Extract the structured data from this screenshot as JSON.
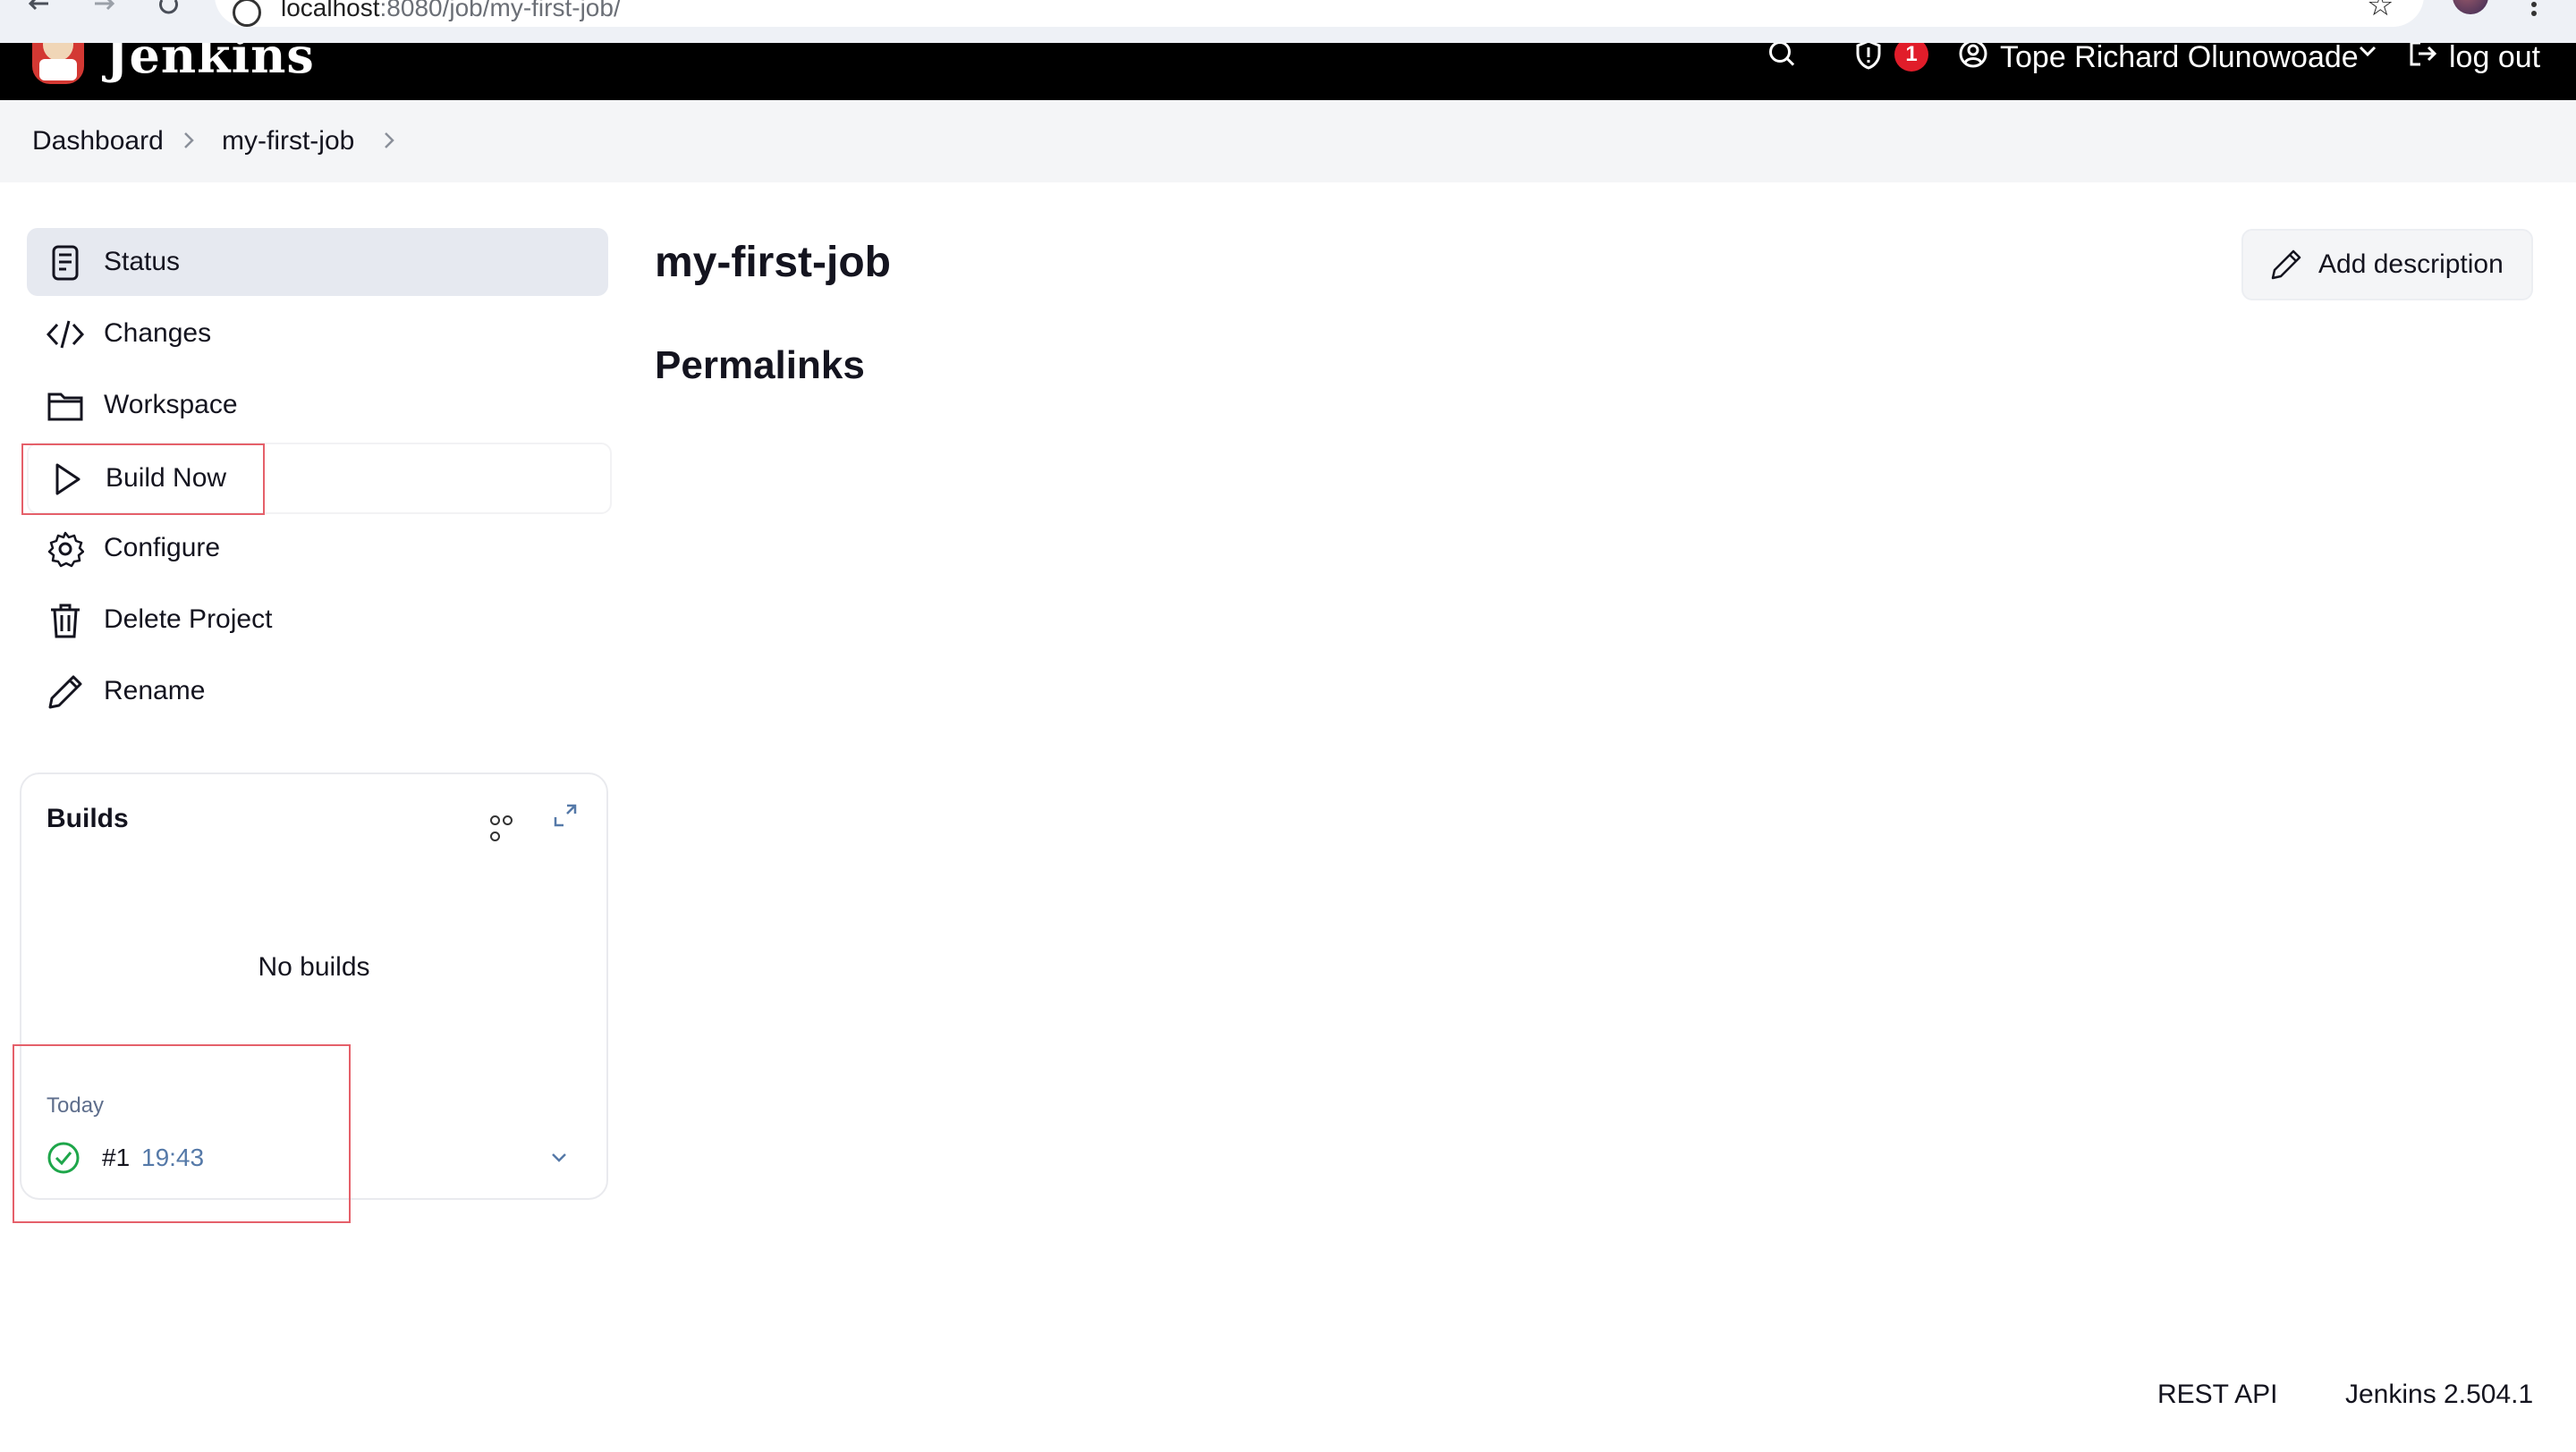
{
  "browser": {
    "url_host": "localhost",
    "url_rest": ":8080/job/my-first-job/"
  },
  "header": {
    "app_title": "Jenkins",
    "notification_count": "1",
    "username": "Tope Richard Olunowoade",
    "logout_label": "log out"
  },
  "breadcrumb": {
    "items": [
      "Dashboard",
      "my-first-job"
    ]
  },
  "sidebar": {
    "tasks": [
      {
        "label": "Status",
        "icon": "status-icon"
      },
      {
        "label": "Changes",
        "icon": "code-icon"
      },
      {
        "label": "Workspace",
        "icon": "folder-icon"
      },
      {
        "label": "Build Now",
        "icon": "play-icon"
      },
      {
        "label": "Configure",
        "icon": "gear-icon"
      },
      {
        "label": "Delete Project",
        "icon": "trash-icon"
      },
      {
        "label": "Rename",
        "icon": "pencil-icon"
      }
    ]
  },
  "builds": {
    "title": "Builds",
    "empty_text": "No builds",
    "group_label": "Today",
    "entries": [
      {
        "number": "#1",
        "time": "19:43",
        "status": "success"
      }
    ]
  },
  "main": {
    "job_title": "my-first-job",
    "permalinks_heading": "Permalinks",
    "add_description_label": "Add description"
  },
  "footer": {
    "rest_api_label": "REST API",
    "version_label": "Jenkins 2.504.1"
  },
  "colors": {
    "header_bg": "#000000",
    "badge": "#e11d2a",
    "success": "#1ea64a",
    "highlight_box": "#e5606a",
    "time_link": "#5579a8"
  }
}
